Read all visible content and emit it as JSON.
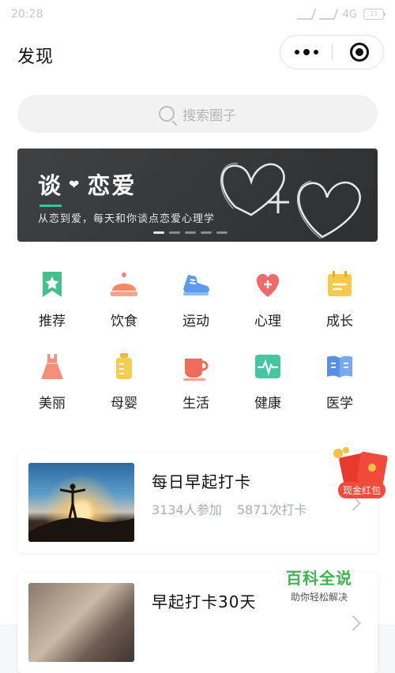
{
  "status_bar": {
    "time": "20:28",
    "network": "4G",
    "battery": "33"
  },
  "nav": {
    "title": "发现"
  },
  "search": {
    "placeholder": "搜索圈子"
  },
  "banner": {
    "title_part1": "谈",
    "title_part2": "恋爱",
    "subtitle": "从恋到爱，每天和你谈点恋爱心理学"
  },
  "categories": [
    {
      "label": "推荐",
      "icon": "bookmark-star-icon",
      "color": "#46c08a"
    },
    {
      "label": "饮食",
      "icon": "dish-cover-icon",
      "color": "#f2876a"
    },
    {
      "label": "运动",
      "icon": "sneaker-icon",
      "color": "#5b9bef"
    },
    {
      "label": "心理",
      "icon": "heart-plus-icon",
      "color": "#f06a6a"
    },
    {
      "label": "成长",
      "icon": "calendar-icon",
      "color": "#f7c948"
    },
    {
      "label": "美丽",
      "icon": "dress-icon",
      "color": "#f58f7a"
    },
    {
      "label": "母婴",
      "icon": "baby-bottle-icon",
      "color": "#f4cd52"
    },
    {
      "label": "生活",
      "icon": "cup-icon",
      "color": "#ef6c5a"
    },
    {
      "label": "健康",
      "icon": "heartbeat-icon",
      "color": "#42c7a0"
    },
    {
      "label": "医学",
      "icon": "book-icon",
      "color": "#5a8fe3"
    }
  ],
  "cards": [
    {
      "title": "每日早起打卡",
      "participants": "3134人参加",
      "checkins": "5871次打卡"
    },
    {
      "title": "早起打卡30天",
      "participants": "",
      "checkins": ""
    }
  ],
  "red_packet": {
    "label": "现金红包"
  },
  "watermark": {
    "main": "百科全说",
    "sub": "助你轻松解决"
  }
}
